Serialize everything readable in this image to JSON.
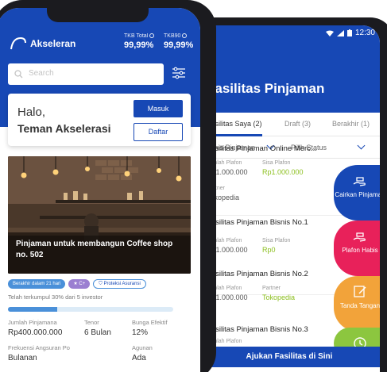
{
  "back_app": {
    "status_time": "12:30",
    "title": "Fasilitas Pinjaman",
    "tabs": [
      {
        "label": "Fasilitas Saya (2)",
        "active": true
      },
      {
        "label": "Draft (3)",
        "active": false
      },
      {
        "label": "Berakhir (1)",
        "active": false
      }
    ],
    "filters": [
      "Jenis Pinjaman",
      "Pilih Status"
    ],
    "cards": [
      {
        "name": "Fasilitas Pinjaman Online Merc...",
        "plafon_label": "Jumlah Plafon",
        "plafon": "Rp1.000.000",
        "sisa_label": "Sisa Plafon",
        "sisa": "Rp1.000.000",
        "partner_label": "Partner",
        "partner": "Tokopedia",
        "badge": "Cairkan Pinjaman",
        "badge_color": "#1748b5",
        "badge_icon": "hand-money-icon"
      },
      {
        "name": "Fasilitas Pinjaman Bisnis No.1",
        "plafon_label": "Jumlah Plafon",
        "plafon": "Rp1.000.000",
        "sisa_label": "Sisa Plafon",
        "sisa": "Rp0",
        "badge": "Plafon Habis",
        "badge_color": "#e8215a",
        "badge_icon": "hand-money-icon"
      },
      {
        "name": "Fasilitas Pinjaman Bisnis No.2",
        "plafon_label": "Jumlah Plafon",
        "plafon": "Rp1.000.000",
        "partner_label": "Partner",
        "partner": "Tokopedia",
        "badge": "Tanda Tangan",
        "badge_color": "#f2a33a",
        "badge_icon": "pen-icon"
      },
      {
        "name": "Fasilitas Pinjaman Bisnis No.3",
        "plafon_label": "Jumlah Plafon",
        "badge": "",
        "badge_color": "#8cc63f",
        "badge_icon": "clock-icon"
      }
    ],
    "apply_button": "Ajukan Fasilitas di Sini"
  },
  "front_app": {
    "logo_text": "Akseleran",
    "tkb_total_label": "TKB Total",
    "tkb_total_value": "99,99%",
    "tkb90_label": "TKB90",
    "tkb90_value": "99,99%",
    "search_placeholder": "Search",
    "greeting_line1": "Halo,",
    "greeting_line2": "Teman Akselerasi",
    "login_button": "Masuk",
    "register_button": "Daftar",
    "loan_title": "Pinjaman untuk membangun Coffee shop no. 502",
    "tags": [
      "Berakhir dalam 21 hari",
      "C+",
      "Proteksi Asuransi"
    ],
    "funded_text": "Telah terkumpul 30% dari 5 investor",
    "funded_fraction": 0.3,
    "stats": [
      {
        "label": "Jumlah Pinjamana",
        "value": "Rp400.000.000"
      },
      {
        "label": "Tenor",
        "value": "6 Bulan"
      },
      {
        "label": "Bunga Efektif",
        "value": "12%"
      },
      {
        "label": "Frekuensi Angsuran Po",
        "value": "Bulanan"
      },
      {
        "label": "Agunan",
        "value": "Ada"
      }
    ]
  },
  "colors": {
    "brand_blue": "#1748b5",
    "accent_blue": "#4a90d9",
    "green": "#8cbf1f",
    "pink": "#e8215a",
    "orange": "#f2a33a"
  }
}
